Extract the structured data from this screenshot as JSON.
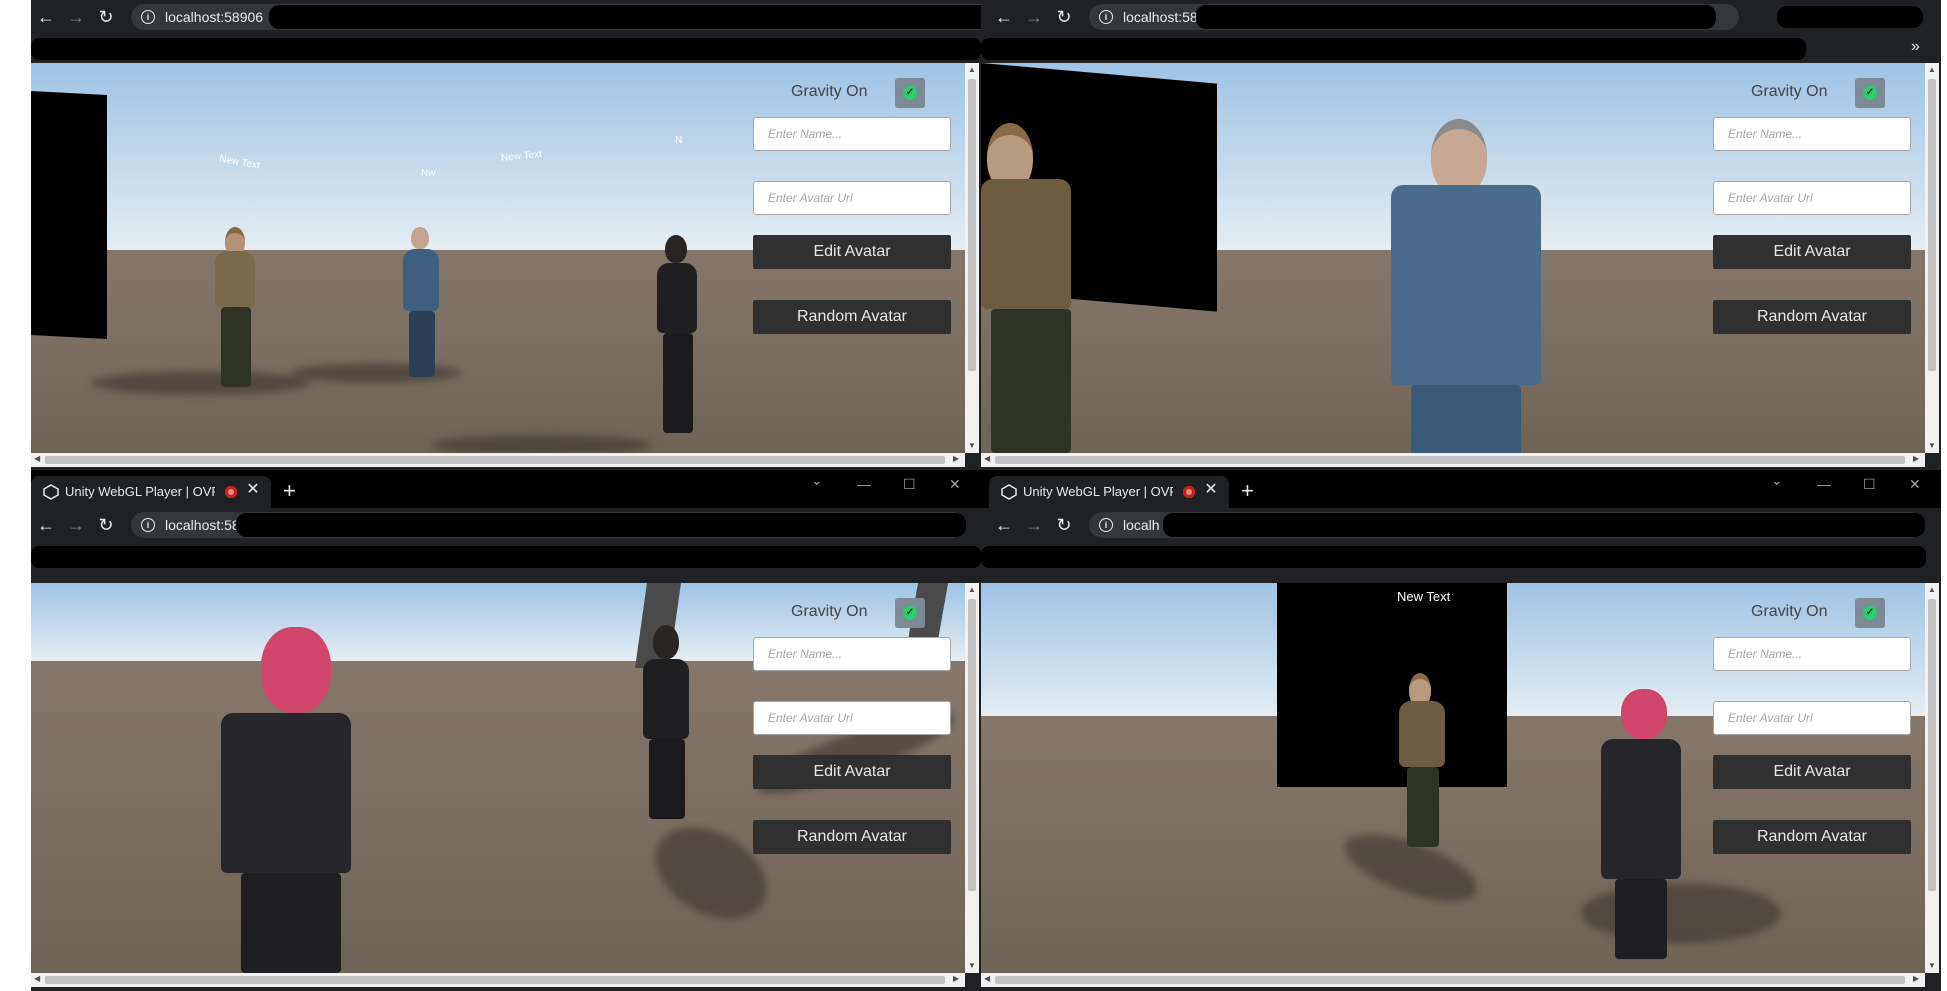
{
  "windows": [
    {
      "id": "top-left",
      "url": "localhost:58906",
      "ui": {
        "gravity_label": "Gravity On",
        "name_placeholder": "Enter Name...",
        "avatar_url_placeholder": "Enter Avatar Url",
        "edit_button": "Edit Avatar",
        "random_button": "Random Avatar"
      },
      "floating_texts": [
        "New Text",
        "Nw",
        "New Text",
        "N"
      ]
    },
    {
      "id": "top-right",
      "url": "localhost:58",
      "ui": {
        "gravity_label": "Gravity On",
        "name_placeholder": "Enter Name...",
        "avatar_url_placeholder": "Enter Avatar Url",
        "edit_button": "Edit Avatar",
        "random_button": "Random Avatar"
      },
      "bookmarks_overflow": "»"
    },
    {
      "id": "bottom-left",
      "tab_title": "Unity WebGL Player | OVRWe",
      "url": "localhost:58",
      "ui": {
        "gravity_label": "Gravity On",
        "name_placeholder": "Enter Name...",
        "avatar_url_placeholder": "Enter Avatar Url",
        "edit_button": "Edit Avatar",
        "random_button": "Random Avatar"
      }
    },
    {
      "id": "bottom-right",
      "tab_title": "Unity WebGL Player | OVRWe",
      "url": "localh",
      "ui": {
        "gravity_label": "Gravity On",
        "name_placeholder": "Enter Name...",
        "avatar_url_placeholder": "Enter Avatar Url",
        "edit_button": "Edit Avatar",
        "random_button": "Random Avatar"
      },
      "floating_texts": [
        "New Text"
      ]
    }
  ],
  "glyphs": {
    "back": "←",
    "forward": "→",
    "reload": "↻",
    "close": "✕",
    "plus": "+",
    "minimize": "—",
    "maximize": "☐",
    "chevron": "⌄",
    "check": "✓",
    "info": "i",
    "arrow_up": "▲",
    "arrow_down": "▼",
    "arrow_left": "◀",
    "arrow_right": "▶"
  },
  "colors": {
    "chrome_dark": "#202124",
    "omnibox": "#35363a",
    "ui_button": "#303030",
    "toggle_bg": "#7c8a96",
    "toggle_check": "#2ecc71"
  }
}
